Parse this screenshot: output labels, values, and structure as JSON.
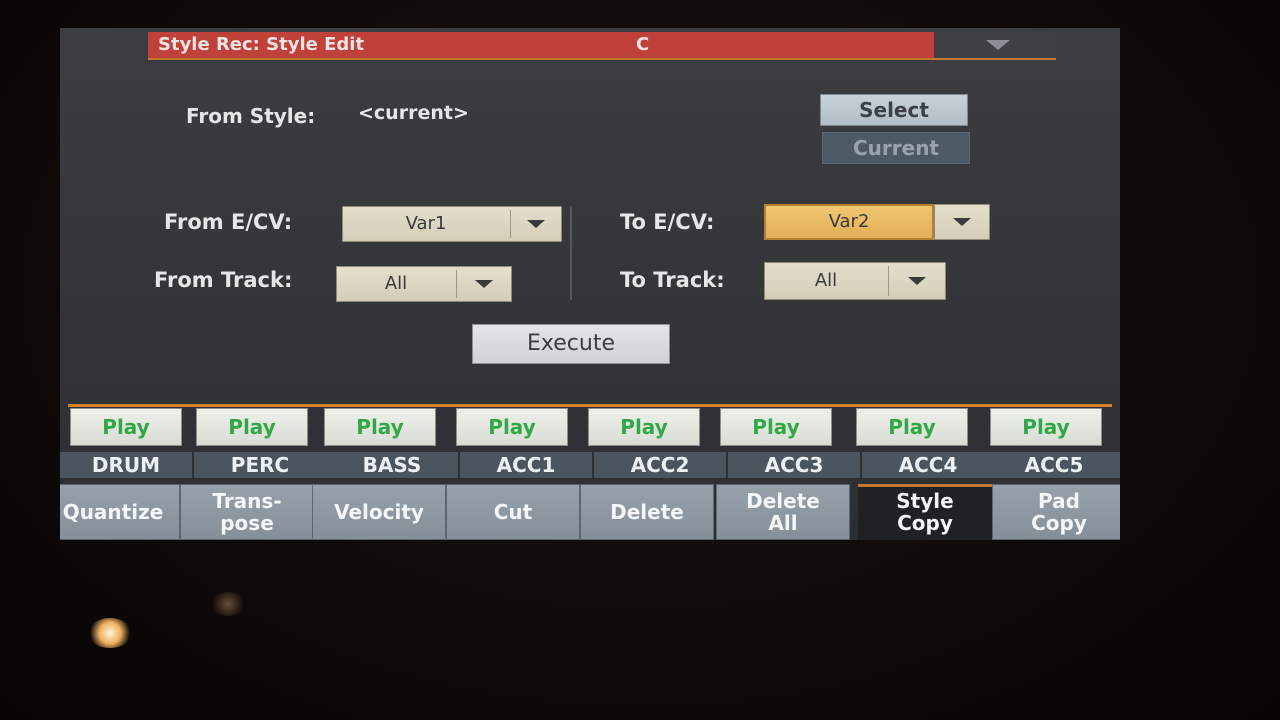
{
  "header": {
    "title": "Style Rec: Style Edit",
    "chord": "C"
  },
  "from_style": {
    "label": "From Style:",
    "value": "<current>"
  },
  "buttons": {
    "select": "Select",
    "current": "Current",
    "execute": "Execute"
  },
  "from_ecv": {
    "label": "From E/CV:",
    "value": "Var1"
  },
  "from_track": {
    "label": "From Track:",
    "value": "All"
  },
  "to_ecv": {
    "label": "To E/CV:",
    "value": "Var2"
  },
  "to_track": {
    "label": "To Track:",
    "value": "All"
  },
  "tracks": [
    {
      "play": "Play",
      "name": "DRUM"
    },
    {
      "play": "Play",
      "name": "PERC"
    },
    {
      "play": "Play",
      "name": "BASS"
    },
    {
      "play": "Play",
      "name": "ACC1"
    },
    {
      "play": "Play",
      "name": "ACC2"
    },
    {
      "play": "Play",
      "name": "ACC3"
    },
    {
      "play": "Play",
      "name": "ACC4"
    },
    {
      "play": "Play",
      "name": "ACC5"
    }
  ],
  "tabs": [
    {
      "line1": "Quantize",
      "line2": ""
    },
    {
      "line1": "Trans-",
      "line2": "pose"
    },
    {
      "line1": "Velocity",
      "line2": ""
    },
    {
      "line1": "Cut",
      "line2": ""
    },
    {
      "line1": "Delete",
      "line2": ""
    },
    {
      "line1": "Delete",
      "line2": "All"
    },
    {
      "line1": "Style",
      "line2": "Copy"
    },
    {
      "line1": "Pad",
      "line2": "Copy"
    }
  ],
  "active_tab": "Style Copy",
  "colors": {
    "title_bar": "#c0403a",
    "accent": "#d57f28",
    "selected_field": "#e8b862",
    "play_text": "#30a845"
  }
}
